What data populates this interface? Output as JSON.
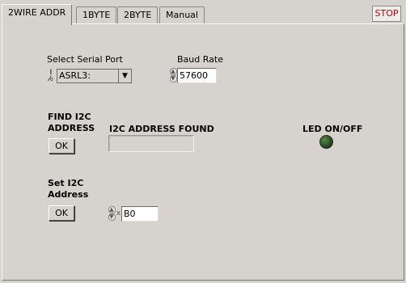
{
  "tabs": [
    "2WIRE ADDR",
    "1BYTE",
    "2BYTE",
    "Manual"
  ],
  "stop_label": "STOP",
  "serial": {
    "label": "Select Serial Port",
    "io_glyph": "I/O",
    "value": "ASRL3:"
  },
  "baud": {
    "label": "Baud Rate",
    "value": "57600"
  },
  "find": {
    "label_line1": "FIND I2C",
    "label_line2": "ADDRESS",
    "ok": "OK"
  },
  "found": {
    "label": "I2C ADDRESS FOUND",
    "value": ""
  },
  "led": {
    "label": "LED ON/OFF",
    "state": "off",
    "color": "#2a4e26"
  },
  "set": {
    "label_line1": "Set I2C",
    "label_line2": "Address",
    "ok": "OK",
    "prefix": "x",
    "value": "B0"
  }
}
